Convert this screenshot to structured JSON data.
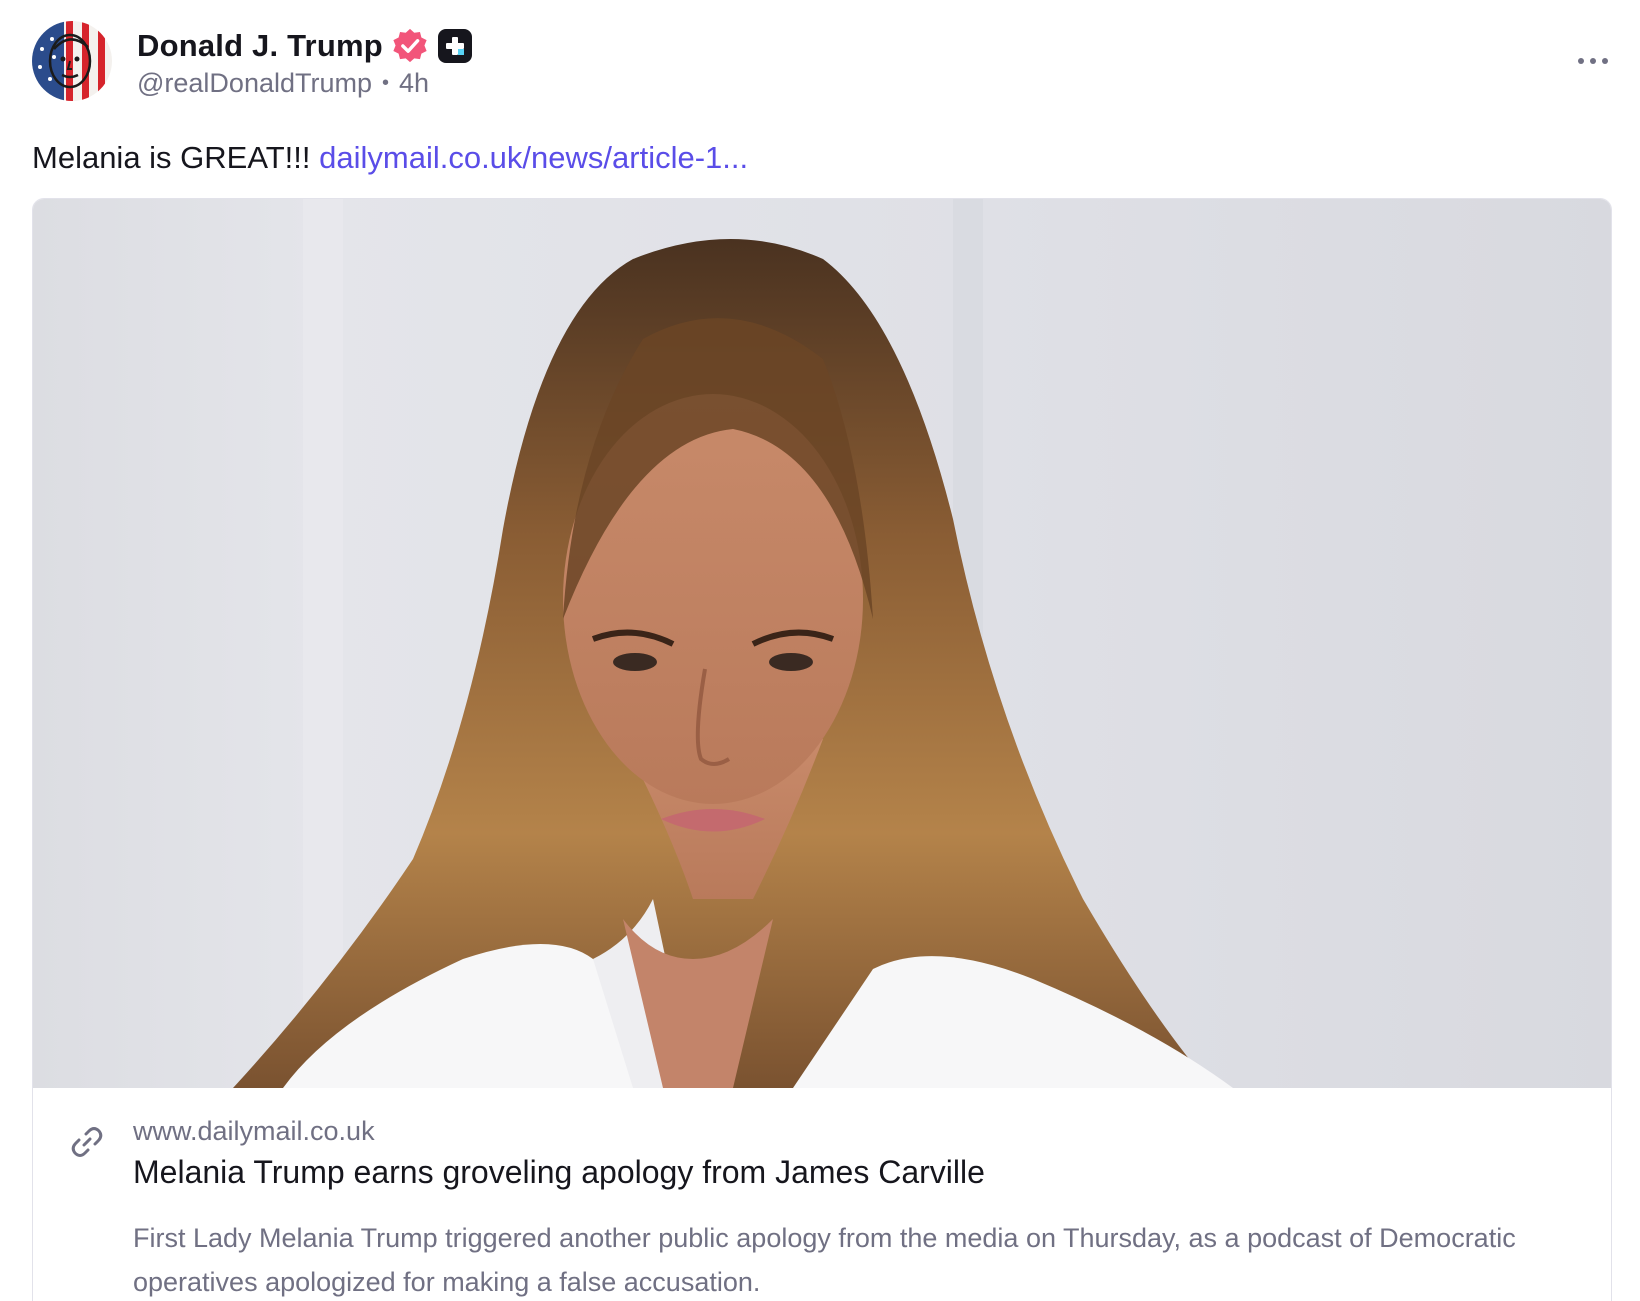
{
  "author": {
    "display_name": "Donald J. Trump",
    "handle": "@realDonaldTrump",
    "separator": "•",
    "timestamp": "4h",
    "avatar_icon": "flag-portrait-avatar",
    "badges": [
      "verified-icon",
      "plus-badge-icon"
    ]
  },
  "post": {
    "text": "Melania is GREAT!!! ",
    "link_text": "dailymail.co.uk/news/article-1..."
  },
  "card": {
    "image_icon": "portrait-photo",
    "domain": "www.dailymail.co.uk",
    "title": "Melania Trump earns groveling apology from James Carville",
    "description": "First Lady Melania Trump triggered another public apology from the media on Thursday, as a podcast of Democratic operatives apologized for making a false accusation."
  },
  "colors": {
    "accent_link": "#5a4de8",
    "verified_badge": "#f2557a",
    "muted_text": "#707083",
    "primary_text": "#16161d"
  }
}
